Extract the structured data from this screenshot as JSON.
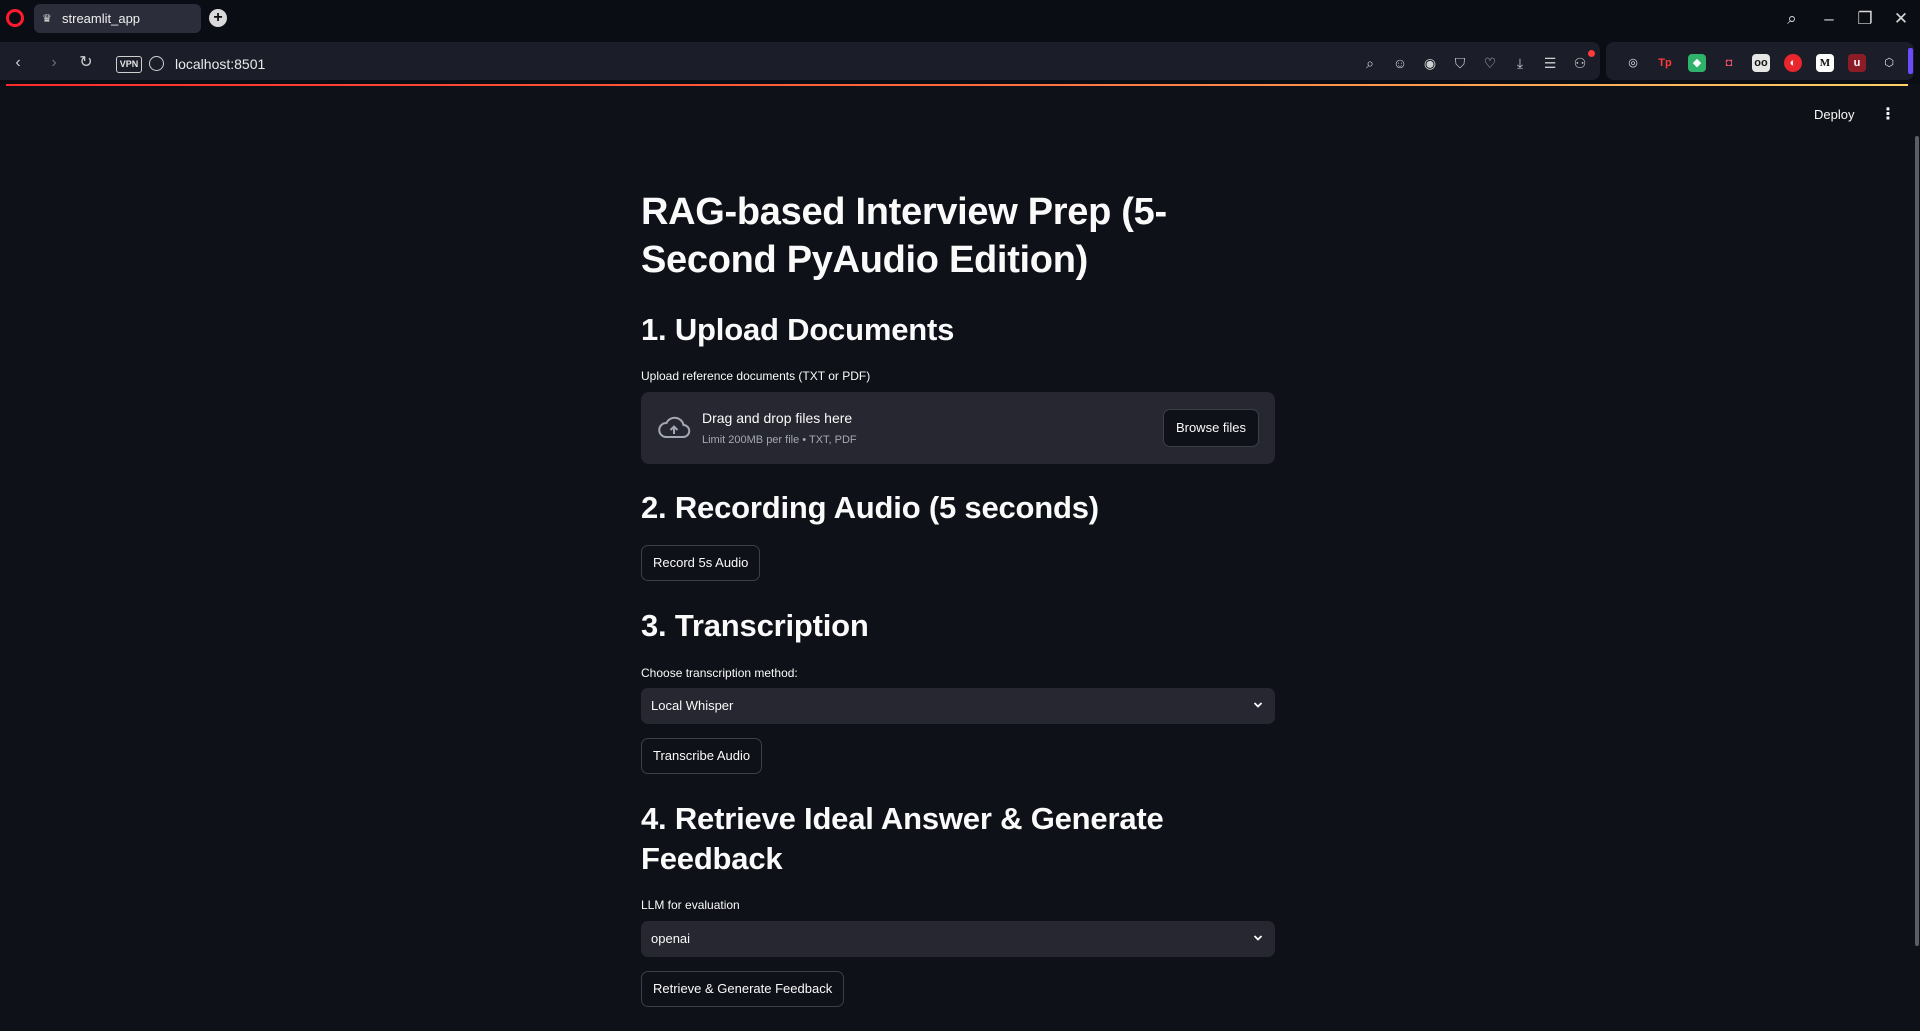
{
  "browser": {
    "tab_title": "streamlit_app",
    "url": "localhost:8501",
    "vpn_label": "VPN"
  },
  "app": {
    "deploy_label": "Deploy",
    "title": "RAG-based Interview Prep (5-Second PyAudio Edition)",
    "sections": {
      "upload": {
        "heading": "1. Upload Documents",
        "label": "Upload reference documents (TXT or PDF)",
        "drop_title": "Drag and drop files here",
        "drop_limit": "Limit 200MB per file • TXT, PDF",
        "browse_label": "Browse files"
      },
      "record": {
        "heading": "2. Recording Audio (5 seconds)",
        "button_label": "Record 5s Audio"
      },
      "transcription": {
        "heading": "3. Transcription",
        "label": "Choose transcription method:",
        "selected": "Local Whisper",
        "button_label": "Transcribe Audio"
      },
      "feedback": {
        "heading": "4. Retrieve Ideal Answer & Generate Feedback",
        "label": "LLM for evaluation",
        "selected": "openai",
        "button_label": "Retrieve & Generate Feedback"
      }
    }
  },
  "colors": {
    "background": "#0e1117",
    "surface": "#262730",
    "text": "#fafafa",
    "muted": "#a3a8b4",
    "accent": "#ff2b2b"
  }
}
